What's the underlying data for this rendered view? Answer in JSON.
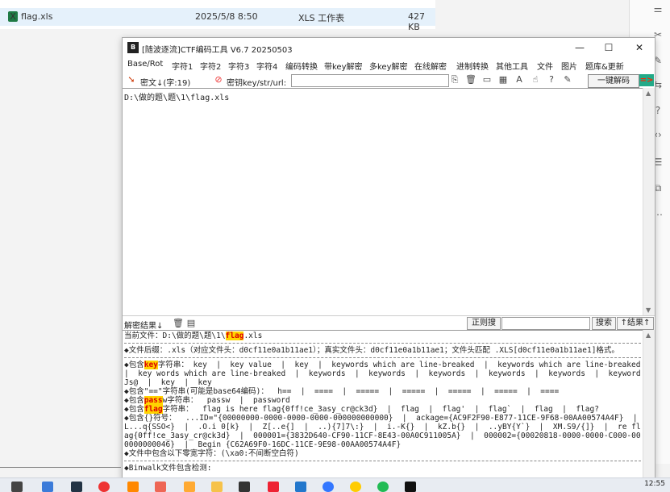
{
  "explorer": {
    "file_name": "flag.xls",
    "file_date": "2025/5/8 8:50",
    "file_type": "XLS 工作表",
    "file_size": "427 KB"
  },
  "window": {
    "title": "[随波逐流]CTF编码工具 V6.7  20250503",
    "minimize": "—",
    "maximize": "☐",
    "close": "✕"
  },
  "menu": [
    "Base/Rot",
    "字符1",
    "字符2",
    "字符3",
    "字符4",
    "编码转换",
    "带key解密",
    "多key解密",
    "在线解密",
    "进制转换",
    "其他工具",
    "文件",
    "图片",
    "题库&更新"
  ],
  "toolbar": {
    "cipher_label": "密文↓(字:19)",
    "key_label": "密钥key/str/url:",
    "key_value": "",
    "decode_button": "一键解码",
    "go_label": "=>"
  },
  "input": {
    "text": "D:\\做的题\\题\\1\\flag.xls"
  },
  "result_bar": {
    "label": "解密结果↓",
    "regex_button": "正则搜",
    "search_value": "",
    "search_button": "搜索",
    "nav_button": "↑结果↑"
  },
  "output": {
    "current_file_prefix": "当前文件：D:\\做的题\\题\\1\\",
    "current_file_hl": "flag",
    "current_file_suffix": ".xls",
    "suffix_line": "◆文件后缀：.xls（对应文件头：d0cf11e0a1b11ae1）；真实文件头：d0cf11e0a1b11ae1；文件头匹配 .XLS[d0cf11e0a1b11ae1]格式。",
    "key_line_prefix": "◆包含",
    "key_word": "key",
    "key_line_mid": "字符串：",
    "key_line_rest": " key  |  key value  |  key  |  keywords which are line-breaked  |  keywords which are line-breaked  |  key words which are line-breaked  |  keywords  |  keywords  |  keywords  |  keywords  |  keywords  |  keywordJs@  |  key  |  key",
    "base64_line": "◆包含\"==\"字符串(可能是base64编码)：  h==  |  ====  |  =====  |  =====  |  =====  |  =====  |  ====",
    "pass_line_prefix": "◆包含",
    "pass_word": "pass",
    "pass_line_rest": "w字符串：  passw  |  password",
    "flag_line_prefix": "◆包含",
    "flag_word": "flag",
    "flag_line_rest": "字符串：  flag is here flag{0ff!ce_3asy_cr@ck3d}  |  flag  |  flag'  |  flag`  |  flag  |  flag?",
    "braces_line": "◆包含{}符号：  ...ID=\"{00000000-0000-0000-0000-000000000000}  |  ackage={AC9F2F90-E877-11CE-9F68-00AA00574A4F}  |  L...q{SSO<}  |  .O.i 0[k}  |  Z[..e{]  |  ..){7]7\\:}  |  i.-K{}  |  kZ.b{}  |  ..yBY{Y`}  |  XM.S9/{]}  |  re flag{0ff!ce_3asy_cr@ck3d}  |  000001={3832D640-CF90-11CF-8E43-00A0C911005A}  |  000002={00020818-0000-0000-C000-000000000046}  |  Begin {C62A69F0-16DC-11CE-9E98-00AA00574A4F}",
    "nbsp_line": "◆文件中包含以下零宽字符：(\\xa0:不间断空白符)",
    "binwalk_line": "◆Binwalk文件包含检测:"
  },
  "taskbar": {
    "time": "12:55"
  }
}
